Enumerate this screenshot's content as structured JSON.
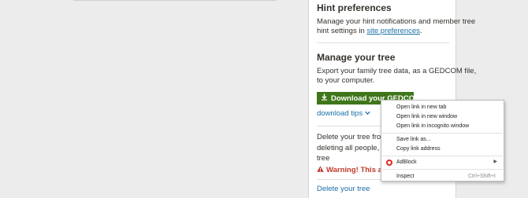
{
  "hint_preferences": {
    "title": "Hint preferences",
    "line1": "Manage your hint notifications and member tree",
    "line2_prefix": "hint settings in ",
    "link": "site preferences",
    "line2_suffix": "."
  },
  "manage_tree": {
    "title": "Manage your tree",
    "line1": "Export your family tree data, as a GEDCOM file,",
    "line2": "to your computer.",
    "download_button": "Download your GEDCOM file",
    "download_tips": "download tips",
    "delete_line1": "Delete your tree from An",
    "delete_line2": "deleting all people, phot",
    "delete_line3": "tree",
    "warning": "Warning! This action",
    "delete_link": "Delete your tree"
  },
  "context_menu": {
    "items": [
      "Open link in new tab",
      "Open link in new window",
      "Open link in incognito window",
      "Save link as...",
      "Copy link address",
      "AdBlock",
      "Inspect"
    ],
    "inspect_shortcut": "Ctrl+Shift+I"
  },
  "colors": {
    "button_green": "#40761b",
    "link_blue": "#1a6fa8",
    "warning_red": "#c0392b",
    "opera_red": "#e0261b"
  },
  "icons": {
    "download": "download-icon",
    "chevron": "chevron-down-icon",
    "warning": "warning-icon",
    "adblock": "opera-icon",
    "submenu": "submenu-arrow-icon"
  }
}
